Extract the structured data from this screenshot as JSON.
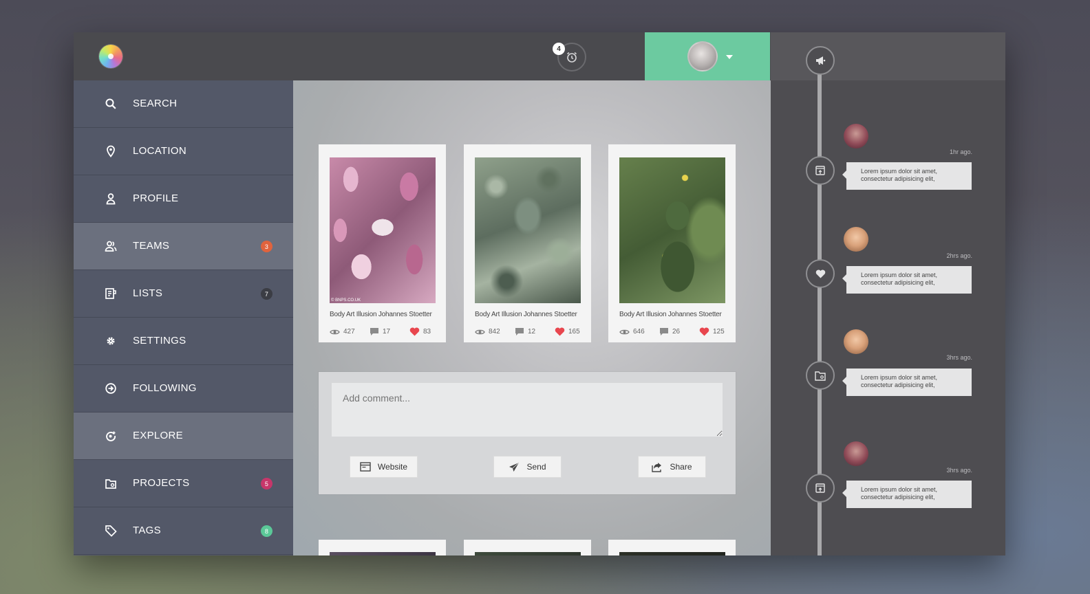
{
  "topbar": {
    "alarm_count": "4"
  },
  "sidebar": {
    "items": [
      {
        "label": "SEARCH",
        "badge": ""
      },
      {
        "label": "LOCATION",
        "badge": ""
      },
      {
        "label": "PROFILE",
        "badge": ""
      },
      {
        "label": "TEAMS",
        "badge": "3",
        "badge_color": "#e0633d"
      },
      {
        "label": "LISTS",
        "badge": "7",
        "badge_color": "#3b3d44"
      },
      {
        "label": "SETTINGS",
        "badge": ""
      },
      {
        "label": "FOLLOWING",
        "badge": ""
      },
      {
        "label": "EXPLORE",
        "badge": ""
      },
      {
        "label": "PROJECTS",
        "badge": "5",
        "badge_color": "#c7366a"
      },
      {
        "label": "TAGS",
        "badge": "8",
        "badge_color": "#5bc898"
      }
    ]
  },
  "cards": [
    {
      "caption": "Body Art Illusion Johannes Stoetter",
      "views": "427",
      "comments": "17",
      "likes": "83",
      "watermark": "© BNPS.CO.UK"
    },
    {
      "caption": "Body Art Illusion Johannes Stoetter",
      "views": "842",
      "comments": "12",
      "likes": "165"
    },
    {
      "caption": "Body Art Illusion Johannes Stoetter",
      "views": "646",
      "comments": "26",
      "likes": "125"
    }
  ],
  "comment": {
    "placeholder": "Add comment...",
    "website_label": "Website",
    "send_label": "Send",
    "share_label": "Share"
  },
  "timeline": {
    "entries": [
      {
        "time": "1hr ago.",
        "text1": "Lorem ipsum dolor sit amet,",
        "text2": "consectetur adipisicing elit,"
      },
      {
        "time": "2hrs ago.",
        "text1": "Lorem ipsum dolor sit amet,",
        "text2": "consectetur adipisicing elit,"
      },
      {
        "time": "3hrs ago.",
        "text1": "Lorem ipsum dolor sit amet,",
        "text2": "consectetur adipisicing elit,"
      },
      {
        "time": "3hrs ago.",
        "text1": "Lorem ipsum dolor sit amet,",
        "text2": "consectetur adipisicing elit,"
      }
    ]
  },
  "colors": {
    "accent": "#6ccaa0",
    "like": "#e8464e"
  }
}
